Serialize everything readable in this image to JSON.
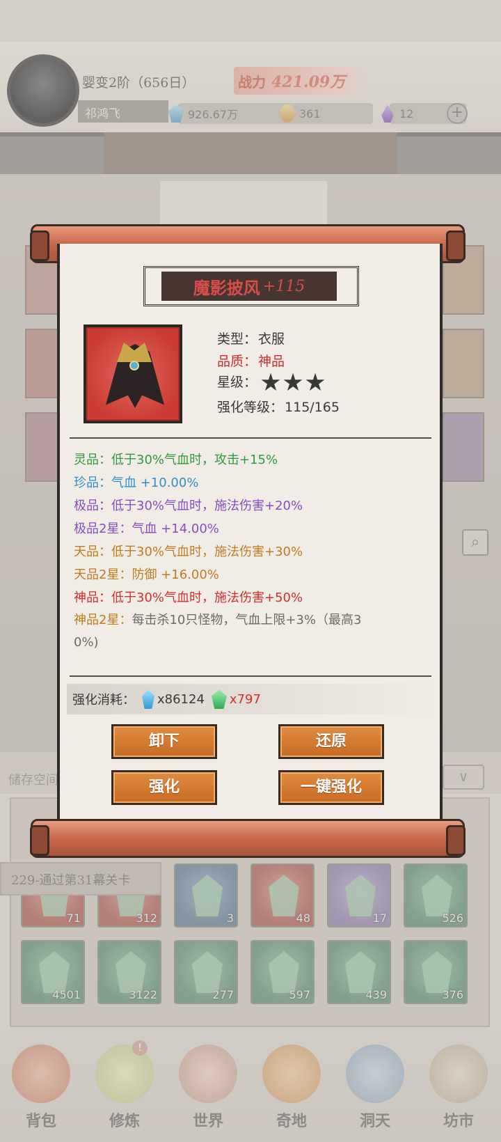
{
  "player": {
    "realm": "婴变2阶（656日）",
    "name": "祁鸿飞",
    "power_label": "战力",
    "power_value": "421.09万"
  },
  "resources": [
    {
      "name": "灵石",
      "value": "926.67万",
      "icon": "spirit-stone-icon"
    },
    {
      "name": "化石",
      "value": "361",
      "icon": "orange-crystal-icon"
    },
    {
      "name": "魂",
      "value": "12",
      "icon": "purple-flame-icon"
    }
  ],
  "modal": {
    "title": "魔影披风",
    "level_tag": "+115",
    "info": {
      "type_label": "类型：",
      "type_value": "衣服",
      "quality_label": "品质：",
      "quality_value": "神品",
      "star_label": "星级：",
      "star_count": 3,
      "enhance_label": "强化等级：",
      "enhance_value": "115/165"
    },
    "effects": [
      {
        "label": "灵品：",
        "text": "低于30%气血时，攻击+15%",
        "color": "green"
      },
      {
        "label": "珍品：",
        "text": "气血 +10.00%",
        "color": "blue"
      },
      {
        "label": "极品：",
        "text": "低于30%气血时，施法伤害+20%",
        "color": "purple"
      },
      {
        "label": "极品2星：",
        "text": "气血 +14.00%",
        "color": "purple"
      },
      {
        "label": "天品：",
        "text": "低于30%气血时，施法伤害+30%",
        "color": "orange"
      },
      {
        "label": "天品2星：",
        "text": "防御 +16.00%",
        "color": "orange"
      },
      {
        "label": "神品：",
        "text": "低于30%气血时，施法伤害+50%",
        "color": "red"
      },
      {
        "label": "神品2星：",
        "text": "每击杀10只怪物，气血上限+3%（最高3",
        "text2": "0%)",
        "color": "gray"
      }
    ],
    "cost": {
      "label": "强化消耗：",
      "item1": "x86124",
      "item2": "x797"
    },
    "buttons": {
      "unequip": "卸下",
      "restore": "还原",
      "enhance": "强化",
      "one_click": "一键强化"
    }
  },
  "storage": {
    "label": "储存空间",
    "quest": "229-通过第31幕关卡"
  },
  "inventory": {
    "row1": [
      {
        "count": "71",
        "color": "red"
      },
      {
        "count": "312",
        "color": "red"
      },
      {
        "count": "3",
        "color": "blue"
      },
      {
        "count": "48",
        "color": "red"
      },
      {
        "count": "17",
        "color": "purple"
      },
      {
        "count": "526",
        "color": "green"
      }
    ],
    "row2": [
      {
        "count": "4501",
        "color": "green"
      },
      {
        "count": "3122",
        "color": "green"
      },
      {
        "count": "277",
        "color": "green"
      },
      {
        "count": "597",
        "color": "green"
      },
      {
        "count": "439",
        "color": "green"
      },
      {
        "count": "376",
        "color": "green"
      }
    ]
  },
  "nav": [
    {
      "label": "背包",
      "icon": "backpack-icon"
    },
    {
      "label": "修炼",
      "icon": "lotus-icon"
    },
    {
      "label": "世界",
      "icon": "world-scroll-icon"
    },
    {
      "label": "奇地",
      "icon": "treasure-land-icon"
    },
    {
      "label": "洞天",
      "icon": "cave-heaven-icon"
    },
    {
      "label": "坊市",
      "icon": "market-icon"
    }
  ],
  "nav_badge": "!",
  "colors": {
    "title_red": "#d94c4c",
    "button_orange": "#d97a30",
    "effect_green": "#2f9a3d",
    "effect_blue": "#2f8fc9",
    "effect_purple": "#8a4cc1",
    "effect_orange": "#c27a1e",
    "effect_red": "#d22e2e"
  }
}
